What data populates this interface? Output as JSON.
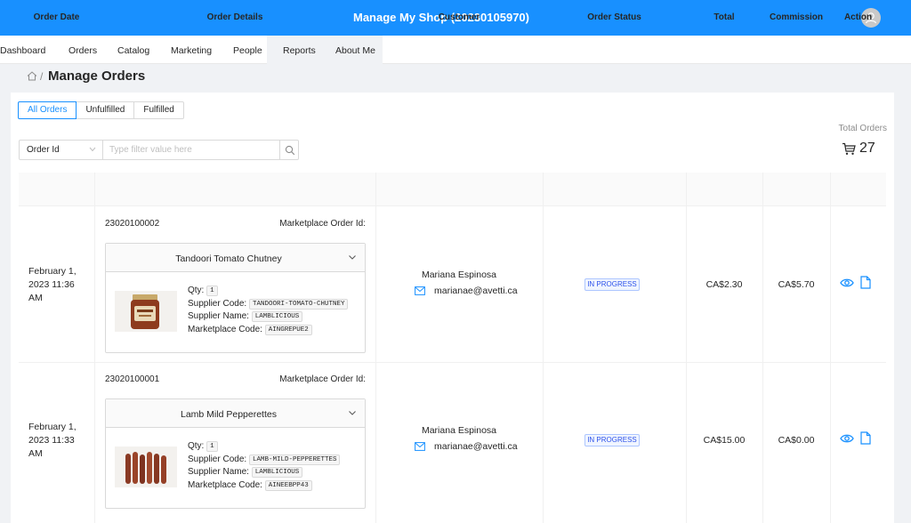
{
  "header": {
    "title": "Manage My Shop (20230105970)"
  },
  "nav": {
    "items": [
      "Dashboard",
      "Orders",
      "Catalog",
      "Marketing",
      "People",
      "Reports",
      "About Me"
    ]
  },
  "breadcrumb": {
    "title": "Manage Orders"
  },
  "tabs": [
    "All Orders",
    "Unfulfilled",
    "Fulfilled"
  ],
  "active_tab": "All Orders",
  "total": {
    "label": "Total Orders",
    "count": "27"
  },
  "filter": {
    "field": "Order Id",
    "placeholder": "Type filter value here"
  },
  "table": {
    "columns": [
      "Order Date",
      "Order Details",
      "Customer",
      "Order Status",
      "Total",
      "Commission",
      "Action"
    ],
    "rows": [
      {
        "date": [
          "February 1,",
          "2023 11:36",
          "AM"
        ],
        "order_id": "23020100002",
        "marketplace_label": "Marketplace Order Id:",
        "product": "Tandoori Tomato Chutney",
        "qty_label": "Qty:",
        "qty": "1",
        "supplier_code_label": "Supplier Code:",
        "supplier_code": "TANDOORI-TOMATO-CHUTNEY",
        "supplier_name_label": "Supplier Name:",
        "supplier_name": "LAMBLICIOUS",
        "marketplace_code_label": "Marketplace Code:",
        "marketplace_code": "AINGREPUE2",
        "customer_name": "Mariana Espinosa",
        "customer_email": "marianae@avetti.ca",
        "status": "IN PROGRESS",
        "total": "CA$2.30",
        "commission": "CA$5.70"
      },
      {
        "date": [
          "February 1,",
          "2023 11:33",
          "AM"
        ],
        "order_id": "23020100001",
        "marketplace_label": "Marketplace Order Id:",
        "product": "Lamb Mild Pepperettes",
        "qty_label": "Qty:",
        "qty": "1",
        "supplier_code_label": "Supplier Code:",
        "supplier_code": "LAMB-MILD-PEPPERETTES",
        "supplier_name_label": "Supplier Name:",
        "supplier_name": "LAMBLICIOUS",
        "marketplace_code_label": "Marketplace Code:",
        "marketplace_code": "AINEEBPP43",
        "customer_name": "Mariana Espinosa",
        "customer_email": "marianae@avetti.ca",
        "status": "IN PROGRESS",
        "total": "CA$15.00",
        "commission": "CA$0.00"
      }
    ]
  },
  "colors": {
    "primary": "#1890ff",
    "status_text": "#2f54eb",
    "status_bg": "#f0f5ff"
  }
}
